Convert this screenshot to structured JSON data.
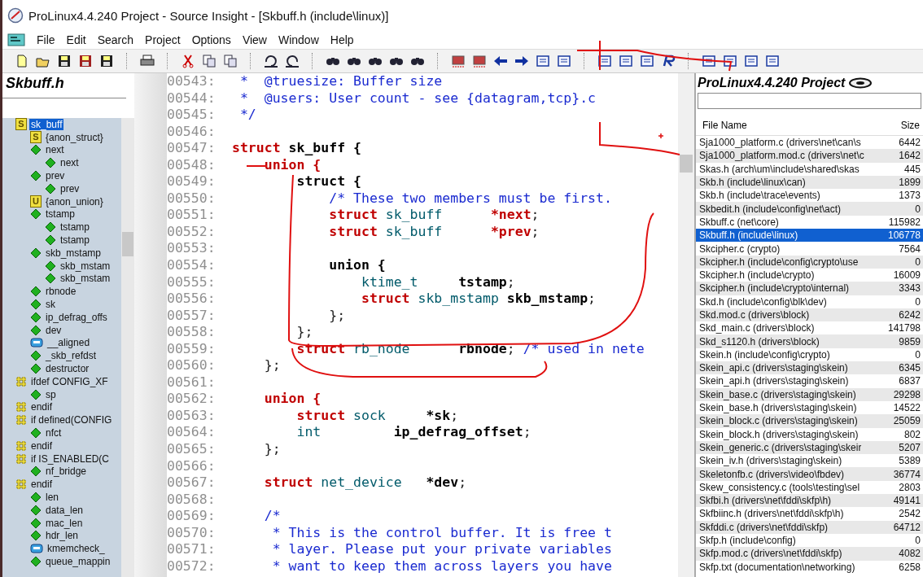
{
  "window": {
    "title": "ProLinux4.4.240 Project - Source Insight - [Skbuff.h (include\\linux)]"
  },
  "menu": [
    "File",
    "Edit",
    "Search",
    "Project",
    "Options",
    "View",
    "Window",
    "Help"
  ],
  "symbol_panel": {
    "title": "Skbuff.h",
    "tree": [
      {
        "label": "sk_buff",
        "kind": "struct",
        "badge": "S",
        "selected": true,
        "children": [
          {
            "label": "{anon_struct}",
            "kind": "struct",
            "badge": "S",
            "selected": false
          },
          {
            "label": "next",
            "kind": "member",
            "selected": false,
            "children": [
              {
                "label": "next",
                "kind": "member",
                "selected": false
              }
            ]
          },
          {
            "label": "prev",
            "kind": "member",
            "selected": false,
            "children": [
              {
                "label": "prev",
                "kind": "member",
                "selected": false
              }
            ]
          },
          {
            "label": "{anon_union}",
            "kind": "union",
            "badge": "U",
            "selected": false
          },
          {
            "label": "tstamp",
            "kind": "member",
            "selected": false,
            "children": [
              {
                "label": "tstamp",
                "kind": "member",
                "selected": false
              },
              {
                "label": "tstamp",
                "kind": "member",
                "selected": false
              }
            ]
          },
          {
            "label": "skb_mstamp",
            "kind": "member",
            "selected": false,
            "children": [
              {
                "label": "skb_mstam",
                "kind": "member",
                "selected": false
              },
              {
                "label": "skb_mstam",
                "kind": "member",
                "selected": false
              }
            ]
          },
          {
            "label": "rbnode",
            "kind": "member",
            "selected": false
          },
          {
            "label": "sk",
            "kind": "member",
            "selected": false
          },
          {
            "label": "ip_defrag_offs",
            "kind": "member",
            "selected": false
          },
          {
            "label": "dev",
            "kind": "member",
            "selected": false
          },
          {
            "label": "__aligned",
            "kind": "macro",
            "selected": false
          },
          {
            "label": "_skb_refdst",
            "kind": "member",
            "selected": false
          },
          {
            "label": "destructor",
            "kind": "member",
            "selected": false
          }
        ]
      },
      {
        "label": "ifdef CONFIG_XF",
        "kind": "preproc",
        "selected": false,
        "children": [
          {
            "label": "sp",
            "kind": "member",
            "selected": false
          }
        ]
      },
      {
        "label": "endif",
        "kind": "preproc",
        "selected": false
      },
      {
        "label": "if defined(CONFIG",
        "kind": "preproc",
        "selected": false,
        "children": [
          {
            "label": "nfct",
            "kind": "member",
            "selected": false
          }
        ]
      },
      {
        "label": "endif",
        "kind": "preproc",
        "selected": false
      },
      {
        "label": "if IS_ENABLED(C",
        "kind": "preproc",
        "selected": false,
        "children": [
          {
            "label": "nf_bridge",
            "kind": "member",
            "selected": false
          }
        ]
      },
      {
        "label": "endif",
        "kind": "preproc",
        "selected": false,
        "children": [
          {
            "label": "len",
            "kind": "member",
            "selected": false
          },
          {
            "label": "data_len",
            "kind": "member",
            "selected": false
          },
          {
            "label": "mac_len",
            "kind": "member",
            "selected": false
          },
          {
            "label": "hdr_len",
            "kind": "member",
            "selected": false
          },
          {
            "label": "kmemcheck_",
            "kind": "macro",
            "selected": false
          },
          {
            "label": "queue_mappin",
            "kind": "member",
            "selected": false
          }
        ]
      }
    ]
  },
  "code": [
    {
      "num": "00543:",
      "tokens": [
        {
          "kind": "comment",
          "text": " *  @truesize: Buffer size"
        }
      ]
    },
    {
      "num": "00544:",
      "tokens": [
        {
          "kind": "comment",
          "text": " *  @users: User count - see {datagram,tcp}.c"
        }
      ]
    },
    {
      "num": "00545:",
      "tokens": [
        {
          "kind": "comment",
          "text": " */"
        }
      ]
    },
    {
      "num": "00546:"
    },
    {
      "num": "00547:",
      "tokens": [
        {
          "kind": "keyword",
          "text": "struct"
        },
        {
          "kind": "name",
          "text": " sk_buff {"
        }
      ]
    },
    {
      "num": "00548:",
      "tokens": [
        {
          "kind": "keyword",
          "text": "    union {"
        }
      ]
    },
    {
      "num": "00549:",
      "tokens": [
        {
          "kind": "name",
          "text": "        struct {"
        }
      ]
    },
    {
      "num": "00550:",
      "tokens": [
        {
          "kind": "comment",
          "text": "            /* These two members must be first."
        }
      ]
    },
    {
      "num": "00551:",
      "tokens": [
        {
          "kind": "keyword",
          "text": "            struct"
        },
        {
          "kind": "type",
          "text": " sk_buff      "
        },
        {
          "kind": "keyword",
          "text": "*next"
        },
        {
          "kind": "plain",
          "text": ";"
        }
      ]
    },
    {
      "num": "00552:",
      "tokens": [
        {
          "kind": "keyword",
          "text": "            struct"
        },
        {
          "kind": "type",
          "text": " sk_buff      "
        },
        {
          "kind": "keyword",
          "text": "*prev"
        },
        {
          "kind": "plain",
          "text": ";"
        }
      ]
    },
    {
      "num": "00553:"
    },
    {
      "num": "00554:",
      "tokens": [
        {
          "kind": "name",
          "text": "            union {"
        }
      ]
    },
    {
      "num": "00555:",
      "tokens": [
        {
          "kind": "type",
          "text": "                ktime_t     "
        },
        {
          "kind": "name",
          "text": "tstamp"
        },
        {
          "kind": "plain",
          "text": ";"
        }
      ]
    },
    {
      "num": "00556:",
      "tokens": [
        {
          "kind": "keyword",
          "text": "                struct"
        },
        {
          "kind": "type",
          "text": " skb_mstamp "
        },
        {
          "kind": "name",
          "text": "skb_mstamp"
        },
        {
          "kind": "plain",
          "text": ";"
        }
      ]
    },
    {
      "num": "00557:",
      "tokens": [
        {
          "kind": "plain",
          "text": "            };"
        }
      ]
    },
    {
      "num": "00558:",
      "tokens": [
        {
          "kind": "plain",
          "text": "        };"
        }
      ]
    },
    {
      "num": "00559:",
      "tokens": [
        {
          "kind": "keyword",
          "text": "        struct"
        },
        {
          "kind": "type",
          "text": " rb_node      "
        },
        {
          "kind": "name",
          "text": "rbnode"
        },
        {
          "kind": "plain",
          "text": "; "
        },
        {
          "kind": "comment",
          "text": "/* used in nete"
        }
      ]
    },
    {
      "num": "00560:",
      "tokens": [
        {
          "kind": "plain",
          "text": "    };"
        }
      ]
    },
    {
      "num": "00561:"
    },
    {
      "num": "00562:",
      "tokens": [
        {
          "kind": "keyword",
          "text": "    union {"
        }
      ]
    },
    {
      "num": "00563:",
      "tokens": [
        {
          "kind": "keyword",
          "text": "        struct"
        },
        {
          "kind": "type",
          "text": " sock     "
        },
        {
          "kind": "name",
          "text": "*sk"
        },
        {
          "kind": "plain",
          "text": ";"
        }
      ]
    },
    {
      "num": "00564:",
      "tokens": [
        {
          "kind": "type",
          "text": "        int         "
        },
        {
          "kind": "name",
          "text": "ip_defrag_offset"
        },
        {
          "kind": "plain",
          "text": ";"
        }
      ]
    },
    {
      "num": "00565:",
      "tokens": [
        {
          "kind": "plain",
          "text": "    };"
        }
      ]
    },
    {
      "num": "00566:"
    },
    {
      "num": "00567:",
      "tokens": [
        {
          "kind": "keyword",
          "text": "    struct"
        },
        {
          "kind": "type",
          "text": " net_device   "
        },
        {
          "kind": "name",
          "text": "*dev"
        },
        {
          "kind": "plain",
          "text": ";"
        }
      ]
    },
    {
      "num": "00568:"
    },
    {
      "num": "00569:",
      "tokens": [
        {
          "kind": "comment",
          "text": "    /*"
        }
      ]
    },
    {
      "num": "00570:",
      "tokens": [
        {
          "kind": "comment",
          "text": "     * This is the control buffer. It is free t"
        }
      ]
    },
    {
      "num": "00571:",
      "tokens": [
        {
          "kind": "comment",
          "text": "     * layer. Please put your private variables"
        }
      ]
    },
    {
      "num": "00572:",
      "tokens": [
        {
          "kind": "comment",
          "text": "     * want to keep them across layers you have"
        }
      ]
    }
  ],
  "project_panel": {
    "title": "ProLinux4.4.240 Project",
    "columns": [
      "File Name",
      "Size"
    ],
    "rows": [
      {
        "name": "Sja1000_platform.c (drivers\\net\\can\\s",
        "size": "6442",
        "selected": false
      },
      {
        "name": "Sja1000_platform.mod.c (drivers\\net\\c",
        "size": "1642",
        "selected": false
      },
      {
        "name": "Skas.h (arch\\um\\include\\shared\\skas",
        "size": "445",
        "selected": false
      },
      {
        "name": "Skb.h (include\\linux\\can)",
        "size": "1899",
        "selected": false
      },
      {
        "name": "Skb.h (include\\trace\\events)",
        "size": "1373",
        "selected": false
      },
      {
        "name": "Skbedit.h (include\\config\\net\\act)",
        "size": "0",
        "selected": false
      },
      {
        "name": "Skbuff.c (net\\core)",
        "size": "115982",
        "selected": false
      },
      {
        "name": "Skbuff.h (include\\linux)",
        "size": "106778",
        "selected": true
      },
      {
        "name": "Skcipher.c (crypto)",
        "size": "7564",
        "selected": false
      },
      {
        "name": "Skcipher.h (include\\config\\crypto\\use",
        "size": "0",
        "selected": false
      },
      {
        "name": "Skcipher.h (include\\crypto)",
        "size": "16009",
        "selected": false
      },
      {
        "name": "Skcipher.h (include\\crypto\\internal)",
        "size": "3343",
        "selected": false
      },
      {
        "name": "Skd.h (include\\config\\blk\\dev)",
        "size": "0",
        "selected": false
      },
      {
        "name": "Skd.mod.c (drivers\\block)",
        "size": "6242",
        "selected": false
      },
      {
        "name": "Skd_main.c (drivers\\block)",
        "size": "141798",
        "selected": false
      },
      {
        "name": "Skd_s1120.h (drivers\\block)",
        "size": "9859",
        "selected": false
      },
      {
        "name": "Skein.h (include\\config\\crypto)",
        "size": "0",
        "selected": false
      },
      {
        "name": "Skein_api.c (drivers\\staging\\skein)",
        "size": "6345",
        "selected": false
      },
      {
        "name": "Skein_api.h (drivers\\staging\\skein)",
        "size": "6837",
        "selected": false
      },
      {
        "name": "Skein_base.c (drivers\\staging\\skein)",
        "size": "29298",
        "selected": false
      },
      {
        "name": "Skein_base.h (drivers\\staging\\skein)",
        "size": "14522",
        "selected": false
      },
      {
        "name": "Skein_block.c (drivers\\staging\\skein)",
        "size": "25059",
        "selected": false
      },
      {
        "name": "Skein_block.h (drivers\\staging\\skein)",
        "size": "802",
        "selected": false
      },
      {
        "name": "Skein_generic.c (drivers\\staging\\skeir",
        "size": "5207",
        "selected": false
      },
      {
        "name": "Skein_iv.h (drivers\\staging\\skein)",
        "size": "5389",
        "selected": false
      },
      {
        "name": "Skeletonfb.c (drivers\\video\\fbdev)",
        "size": "36774",
        "selected": false
      },
      {
        "name": "Skew_consistency.c (tools\\testing\\sel",
        "size": "2803",
        "selected": false
      },
      {
        "name": "Skfbi.h (drivers\\net\\fddi\\skfp\\h)",
        "size": "49141",
        "selected": false
      },
      {
        "name": "Skfbiinc.h (drivers\\net\\fddi\\skfp\\h)",
        "size": "2542",
        "selected": false
      },
      {
        "name": "Skfddi.c (drivers\\net\\fddi\\skfp)",
        "size": "64712",
        "selected": false
      },
      {
        "name": "Skfp.h (include\\config)",
        "size": "0",
        "selected": false
      },
      {
        "name": "Skfp.mod.c (drivers\\net\\fddi\\skfp)",
        "size": "4082",
        "selected": false
      },
      {
        "name": "Skfp.txt (documentation\\networking)",
        "size": "6258",
        "selected": false
      }
    ]
  }
}
